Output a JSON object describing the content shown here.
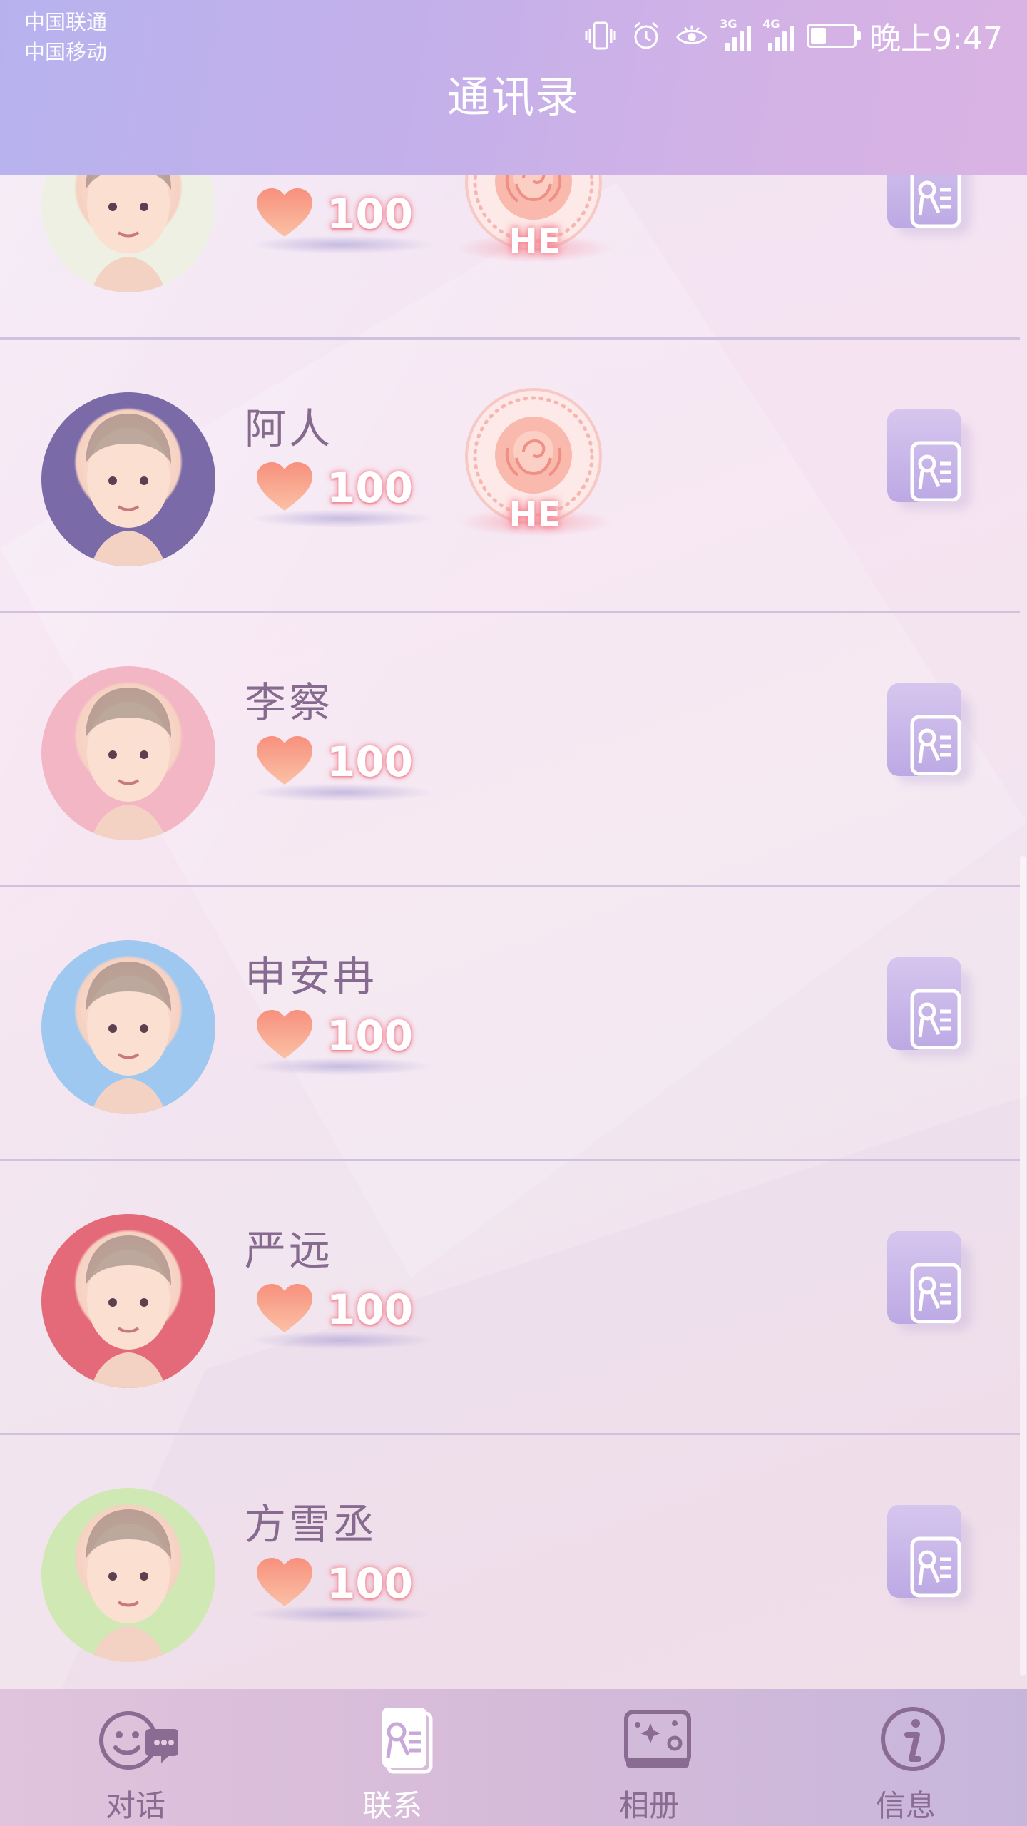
{
  "status_bar": {
    "carrier_1": "中国联通",
    "carrier_2": "中国移动",
    "net_1": "3G",
    "net_2": "4G",
    "battery_percent": 35,
    "time": "晚上9:47"
  },
  "header": {
    "title": "通讯录"
  },
  "contacts": [
    {
      "name": "",
      "affection": "100",
      "badge": "HE",
      "avatar": "black-hair-boy",
      "avatar_bg": "#eef0e4"
    },
    {
      "name": "阿人",
      "affection": "100",
      "badge": "HE",
      "avatar": "short-hair-man",
      "avatar_bg": "#7a6aa8"
    },
    {
      "name": "李察",
      "affection": "100",
      "badge": "",
      "avatar": "police-cap-boy",
      "avatar_bg": "#f2b6c4"
    },
    {
      "name": "申安冉",
      "affection": "100",
      "badge": "",
      "avatar": "blue-hair-glasses-boy",
      "avatar_bg": "#9ec8f0"
    },
    {
      "name": "严远",
      "affection": "100",
      "badge": "",
      "avatar": "red-hair-boy",
      "avatar_bg": "#e46a7a"
    },
    {
      "name": "方雪丞",
      "affection": "100",
      "badge": "",
      "avatar": "green-hair-boy",
      "avatar_bg": "#cfe8b4"
    }
  ],
  "nav": [
    {
      "label": "对话",
      "icon": "chat-face-icon",
      "active": false
    },
    {
      "label": "联系",
      "icon": "contact-card-icon",
      "active": true
    },
    {
      "label": "相册",
      "icon": "album-icon",
      "active": false
    },
    {
      "label": "信息",
      "icon": "info-icon",
      "active": false
    }
  ],
  "colors": {
    "header": "#c3b0ea",
    "name_text": "#876a8f",
    "heart": "#f7907d",
    "nav_bg": "#d6bbd9"
  }
}
